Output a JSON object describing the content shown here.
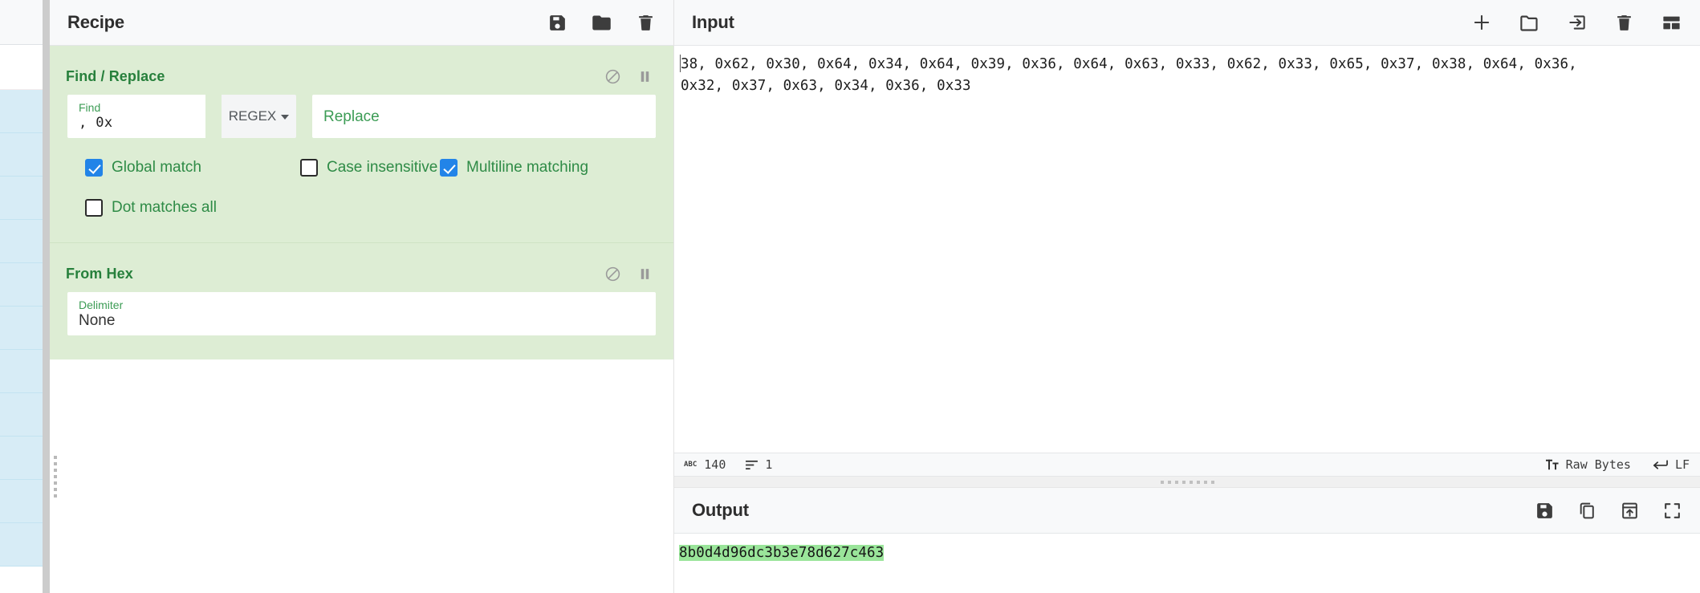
{
  "recipe": {
    "title": "Recipe",
    "toolbar": [
      {
        "name": "save-recipe-icon",
        "label": "Save recipe"
      },
      {
        "name": "load-recipe-icon",
        "label": "Load recipe"
      },
      {
        "name": "clear-recipe-icon",
        "label": "Clear recipe"
      }
    ],
    "operations": [
      {
        "name": "Find / Replace",
        "controls": [
          {
            "name": "disable-operation-icon",
            "label": "Disable operation"
          },
          {
            "name": "pause-operation-icon",
            "label": "Set breakpoint"
          }
        ],
        "args": {
          "find_label": "Find",
          "find_value": ", 0x",
          "find_type": "REGEX",
          "replace_placeholder": "Replace",
          "replace_value": ""
        },
        "checkboxes": [
          {
            "label": "Global match",
            "checked": true
          },
          {
            "label": "Case insensitive",
            "checked": false
          },
          {
            "label": "Multiline matching",
            "checked": true
          },
          {
            "label": "Dot matches all",
            "checked": false
          }
        ]
      },
      {
        "name": "From Hex",
        "controls": [
          {
            "name": "disable-operation-icon",
            "label": "Disable operation"
          },
          {
            "name": "pause-operation-icon",
            "label": "Set breakpoint"
          }
        ],
        "args": {
          "delimiter_label": "Delimiter",
          "delimiter_value": "None"
        }
      }
    ]
  },
  "input": {
    "title": "Input",
    "toolbar": [
      {
        "name": "add-input-tab-icon",
        "label": "Add a new input tab"
      },
      {
        "name": "open-folder-as-input-icon",
        "label": "Open folder as input"
      },
      {
        "name": "open-file-as-input-icon",
        "label": "Open file as input"
      },
      {
        "name": "clear-io-icon",
        "label": "Clear input and output"
      },
      {
        "name": "reset-pane-layout-icon",
        "label": "Reset pane layout"
      }
    ],
    "lines": [
      "38, 0x62, 0x30, 0x64, 0x34, 0x64, 0x39, 0x36, 0x64, 0x63, 0x33, 0x62, 0x33, 0x65, 0x37, 0x38, 0x64, 0x36,",
      "0x32, 0x37, 0x63, 0x34, 0x36, 0x33"
    ],
    "status": {
      "length_icon": "abc",
      "length_label": "ABC",
      "length": "140",
      "lines_icon": "lines-icon",
      "lines": "1",
      "encoding_icon": "font-icon",
      "encoding": "Raw Bytes",
      "line_ending_icon": "return-arrow-icon",
      "line_ending": "LF"
    }
  },
  "output": {
    "title": "Output",
    "toolbar": [
      {
        "name": "save-output-icon",
        "label": "Save output to file"
      },
      {
        "name": "copy-output-icon",
        "label": "Copy raw output to the clipboard"
      },
      {
        "name": "replace-input-with-output-icon",
        "label": "Replace input with output"
      },
      {
        "name": "maximise-output-icon",
        "label": "Maximise output pane"
      }
    ],
    "value": "8b0d4d96dc3b3e78d627c463"
  },
  "colors": {
    "operation_bg": "#ddedd4",
    "operation_title": "#27803c",
    "checkbox_checked": "#2284e8",
    "label_green": "#3c9c55",
    "output_highlight": "#9ae59a",
    "ops_list_item": "#d7ecf6"
  }
}
